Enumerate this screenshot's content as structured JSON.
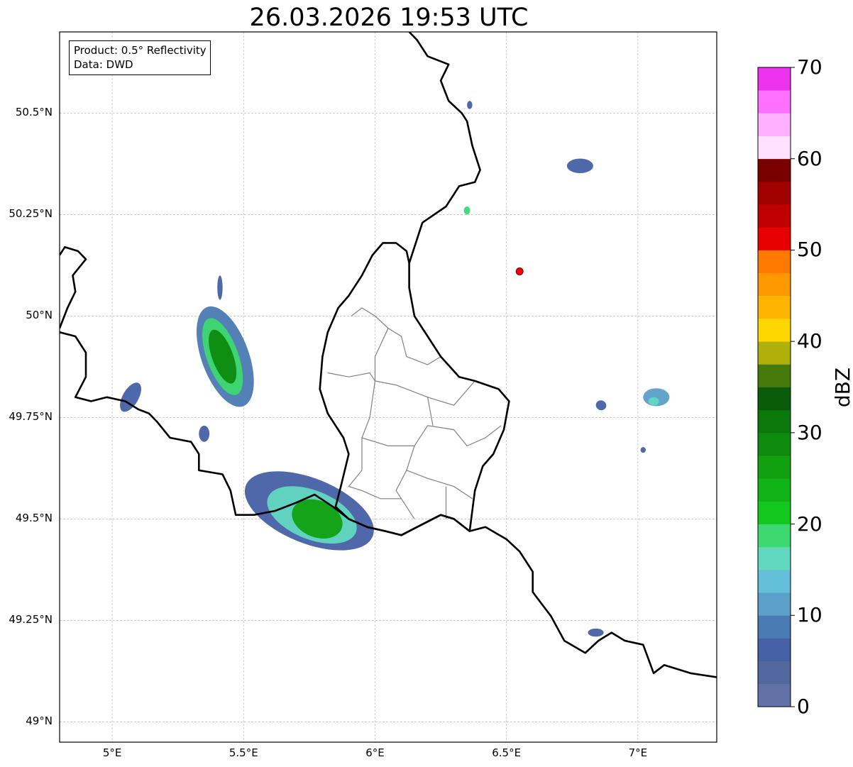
{
  "title": "26.03.2026 19:53 UTC",
  "info": {
    "product": "Product: 0.5° Reflectivity",
    "data": "Data: DWD"
  },
  "map_extent": {
    "lon_min": 4.8,
    "lon_max": 7.3,
    "lat_min": 48.95,
    "lat_max": 50.7
  },
  "x_ticks": [
    {
      "lon": 5.0,
      "label": "5°E"
    },
    {
      "lon": 5.5,
      "label": "5.5°E"
    },
    {
      "lon": 6.0,
      "label": "6°E"
    },
    {
      "lon": 6.5,
      "label": "6.5°E"
    },
    {
      "lon": 7.0,
      "label": "7°E"
    }
  ],
  "y_ticks": [
    {
      "lat": 49.0,
      "label": "49°N"
    },
    {
      "lat": 49.25,
      "label": "49.25°N"
    },
    {
      "lat": 49.5,
      "label": "49.5°N"
    },
    {
      "lat": 49.75,
      "label": "49.75°N"
    },
    {
      "lat": 50.0,
      "label": "50°N"
    },
    {
      "lat": 50.25,
      "label": "50.25°N"
    },
    {
      "lat": 50.5,
      "label": "50.5°N"
    }
  ],
  "marker": {
    "lon": 6.55,
    "lat": 50.11,
    "color": "#ff0000"
  },
  "colorbar": {
    "label": "dBZ",
    "min": 0,
    "max": 70,
    "tick_labels": [
      "0",
      "10",
      "20",
      "30",
      "40",
      "50",
      "60",
      "70"
    ],
    "colors": [
      "#6272a8",
      "#5468a0",
      "#4660a5",
      "#4a7ab2",
      "#5aa0c8",
      "#64c0d8",
      "#62d8c0",
      "#3ed870",
      "#12c81e",
      "#10b416",
      "#10a010",
      "#0e8a0e",
      "#0a780a",
      "#0a5c0a",
      "#467a0a",
      "#b0b00a",
      "#ffd700",
      "#ffb400",
      "#ff9800",
      "#ff7800",
      "#e60000",
      "#c00000",
      "#a00000",
      "#7a0000",
      "#ffe0ff",
      "#ffb0ff",
      "#ff70ff",
      "#ee33ee"
    ]
  },
  "echoes": [
    {
      "lon": 5.43,
      "lat": 49.9,
      "rx": 0.09,
      "ry": 0.13,
      "rot": -20,
      "dbz": 8
    },
    {
      "lon": 5.42,
      "lat": 49.9,
      "rx": 0.06,
      "ry": 0.1,
      "rot": -20,
      "dbz": 18
    },
    {
      "lon": 5.42,
      "lat": 49.9,
      "rx": 0.04,
      "ry": 0.07,
      "rot": -20,
      "dbz": 28
    },
    {
      "lon": 5.75,
      "lat": 49.52,
      "rx": 0.26,
      "ry": 0.08,
      "rot": 22,
      "dbz": 7
    },
    {
      "lon": 5.76,
      "lat": 49.51,
      "rx": 0.18,
      "ry": 0.06,
      "rot": 22,
      "dbz": 16
    },
    {
      "lon": 5.78,
      "lat": 49.5,
      "rx": 0.1,
      "ry": 0.045,
      "rot": 22,
      "dbz": 25
    },
    {
      "lon": 5.07,
      "lat": 49.8,
      "rx": 0.03,
      "ry": 0.04,
      "rot": 30,
      "dbz": 6
    },
    {
      "lon": 5.35,
      "lat": 49.71,
      "rx": 0.02,
      "ry": 0.02,
      "rot": 0,
      "dbz": 7
    },
    {
      "lon": 5.41,
      "lat": 50.07,
      "rx": 0.01,
      "ry": 0.03,
      "rot": 0,
      "dbz": 6
    },
    {
      "lon": 6.78,
      "lat": 50.37,
      "rx": 0.05,
      "ry": 0.018,
      "rot": 0,
      "dbz": 6
    },
    {
      "lon": 6.35,
      "lat": 50.26,
      "rx": 0.012,
      "ry": 0.01,
      "rot": 0,
      "dbz": 18
    },
    {
      "lon": 6.36,
      "lat": 50.52,
      "rx": 0.01,
      "ry": 0.01,
      "rot": 0,
      "dbz": 6
    },
    {
      "lon": 7.07,
      "lat": 49.8,
      "rx": 0.05,
      "ry": 0.022,
      "rot": 0,
      "dbz": 10
    },
    {
      "lon": 7.06,
      "lat": 49.79,
      "rx": 0.02,
      "ry": 0.01,
      "rot": 0,
      "dbz": 17
    },
    {
      "lon": 6.86,
      "lat": 49.78,
      "rx": 0.02,
      "ry": 0.012,
      "rot": 20,
      "dbz": 6
    },
    {
      "lon": 6.84,
      "lat": 49.22,
      "rx": 0.03,
      "ry": 0.01,
      "rot": 0,
      "dbz": 6
    },
    {
      "lon": 7.02,
      "lat": 49.67,
      "rx": 0.01,
      "ry": 0.007,
      "rot": 0,
      "dbz": 6
    }
  ],
  "borders": [
    [
      [
        4.8,
        49.97
      ],
      [
        4.83,
        50.02
      ],
      [
        4.86,
        50.06
      ],
      [
        4.85,
        50.1
      ],
      [
        4.9,
        50.14
      ],
      [
        4.87,
        50.16
      ],
      [
        4.82,
        50.17
      ],
      [
        4.8,
        50.15
      ]
    ],
    [
      [
        4.8,
        49.96
      ],
      [
        4.86,
        49.95
      ],
      [
        4.9,
        49.91
      ],
      [
        4.9,
        49.85
      ],
      [
        4.86,
        49.8
      ],
      [
        4.92,
        49.79
      ],
      [
        4.98,
        49.8
      ],
      [
        5.05,
        49.79
      ],
      [
        5.1,
        49.77
      ],
      [
        5.14,
        49.76
      ],
      [
        5.17,
        49.74
      ],
      [
        5.22,
        49.7
      ],
      [
        5.3,
        49.69
      ],
      [
        5.33,
        49.66
      ],
      [
        5.33,
        49.62
      ],
      [
        5.42,
        49.61
      ],
      [
        5.45,
        49.57
      ],
      [
        5.47,
        49.51
      ],
      [
        5.54,
        49.51
      ],
      [
        5.62,
        49.52
      ],
      [
        5.7,
        49.54
      ],
      [
        5.77,
        49.56
      ],
      [
        5.84,
        49.53
      ],
      [
        5.9,
        49.5
      ],
      [
        5.97,
        49.48
      ],
      [
        6.04,
        49.47
      ],
      [
        6.1,
        49.46
      ],
      [
        6.16,
        49.48
      ],
      [
        6.25,
        49.51
      ],
      [
        6.3,
        49.5
      ],
      [
        6.36,
        49.47
      ],
      [
        6.42,
        49.48
      ],
      [
        6.5,
        49.45
      ],
      [
        6.55,
        49.42
      ],
      [
        6.6,
        49.37
      ],
      [
        6.6,
        49.32
      ],
      [
        6.67,
        49.26
      ],
      [
        6.72,
        49.2
      ],
      [
        6.8,
        49.17
      ],
      [
        6.85,
        49.2
      ],
      [
        6.9,
        49.22
      ],
      [
        6.95,
        49.2
      ],
      [
        7.02,
        49.19
      ],
      [
        7.06,
        49.12
      ],
      [
        7.1,
        49.14
      ],
      [
        7.2,
        49.12
      ],
      [
        7.3,
        49.11
      ]
    ],
    [
      [
        6.13,
        50.13
      ],
      [
        6.12,
        50.16
      ],
      [
        6.08,
        50.18
      ],
      [
        6.03,
        50.18
      ],
      [
        5.99,
        50.15
      ],
      [
        5.95,
        50.1
      ],
      [
        5.9,
        50.05
      ],
      [
        5.86,
        50.02
      ],
      [
        5.82,
        49.96
      ],
      [
        5.8,
        49.9
      ],
      [
        5.79,
        49.82
      ],
      [
        5.82,
        49.76
      ],
      [
        5.88,
        49.7
      ],
      [
        5.9,
        49.66
      ],
      [
        5.87,
        49.58
      ],
      [
        5.85,
        49.53
      ],
      [
        5.9,
        49.5
      ],
      [
        5.97,
        49.48
      ],
      [
        6.04,
        49.47
      ],
      [
        6.1,
        49.46
      ],
      [
        6.16,
        49.48
      ],
      [
        6.25,
        49.51
      ],
      [
        6.3,
        49.5
      ],
      [
        6.36,
        49.47
      ],
      [
        6.37,
        49.52
      ],
      [
        6.38,
        49.57
      ],
      [
        6.41,
        49.63
      ],
      [
        6.45,
        49.66
      ],
      [
        6.49,
        49.72
      ],
      [
        6.51,
        49.79
      ],
      [
        6.47,
        49.82
      ],
      [
        6.38,
        49.84
      ],
      [
        6.32,
        49.85
      ],
      [
        6.25,
        49.9
      ],
      [
        6.2,
        49.95
      ],
      [
        6.15,
        50.0
      ],
      [
        6.13,
        50.07
      ],
      [
        6.13,
        50.13
      ]
    ],
    [
      [
        6.13,
        50.13
      ],
      [
        6.18,
        50.23
      ],
      [
        6.27,
        50.27
      ],
      [
        6.32,
        50.32
      ],
      [
        6.38,
        50.33
      ],
      [
        6.4,
        50.36
      ],
      [
        6.37,
        50.42
      ],
      [
        6.35,
        50.48
      ],
      [
        6.33,
        50.5
      ],
      [
        6.28,
        50.53
      ],
      [
        6.25,
        50.58
      ],
      [
        6.28,
        50.62
      ],
      [
        6.2,
        50.64
      ],
      [
        6.16,
        50.68
      ],
      [
        6.13,
        50.7
      ]
    ]
  ],
  "districts": [
    [
      [
        5.91,
        50.0
      ],
      [
        5.95,
        50.02
      ],
      [
        6.0,
        50.0
      ],
      [
        6.05,
        49.97
      ],
      [
        6.1,
        49.95
      ],
      [
        6.12,
        49.9
      ],
      [
        6.2,
        49.88
      ],
      [
        6.25,
        49.9
      ]
    ],
    [
      [
        6.05,
        49.97
      ],
      [
        6.0,
        49.9
      ],
      [
        6.0,
        49.84
      ],
      [
        6.08,
        49.83
      ],
      [
        6.2,
        49.8
      ],
      [
        6.3,
        49.78
      ],
      [
        6.38,
        49.84
      ]
    ],
    [
      [
        5.82,
        49.86
      ],
      [
        5.9,
        49.85
      ],
      [
        5.98,
        49.86
      ],
      [
        6.0,
        49.84
      ]
    ],
    [
      [
        6.0,
        49.84
      ],
      [
        5.98,
        49.75
      ],
      [
        5.95,
        49.7
      ],
      [
        5.95,
        49.62
      ],
      [
        5.9,
        49.58
      ],
      [
        5.95,
        49.57
      ],
      [
        6.02,
        49.55
      ],
      [
        6.1,
        49.55
      ],
      [
        6.15,
        49.5
      ]
    ],
    [
      [
        5.95,
        49.7
      ],
      [
        6.05,
        49.68
      ],
      [
        6.15,
        49.68
      ],
      [
        6.2,
        49.73
      ],
      [
        6.3,
        49.72
      ],
      [
        6.35,
        49.68
      ],
      [
        6.42,
        49.7
      ],
      [
        6.48,
        49.73
      ]
    ],
    [
      [
        6.2,
        49.8
      ],
      [
        6.22,
        49.73
      ]
    ],
    [
      [
        6.15,
        49.68
      ],
      [
        6.12,
        49.62
      ],
      [
        6.2,
        49.6
      ],
      [
        6.3,
        49.58
      ],
      [
        6.37,
        49.55
      ]
    ],
    [
      [
        6.12,
        49.62
      ],
      [
        6.08,
        49.57
      ],
      [
        6.1,
        49.55
      ]
    ],
    [
      [
        6.27,
        49.58
      ],
      [
        6.27,
        49.5
      ]
    ]
  ]
}
